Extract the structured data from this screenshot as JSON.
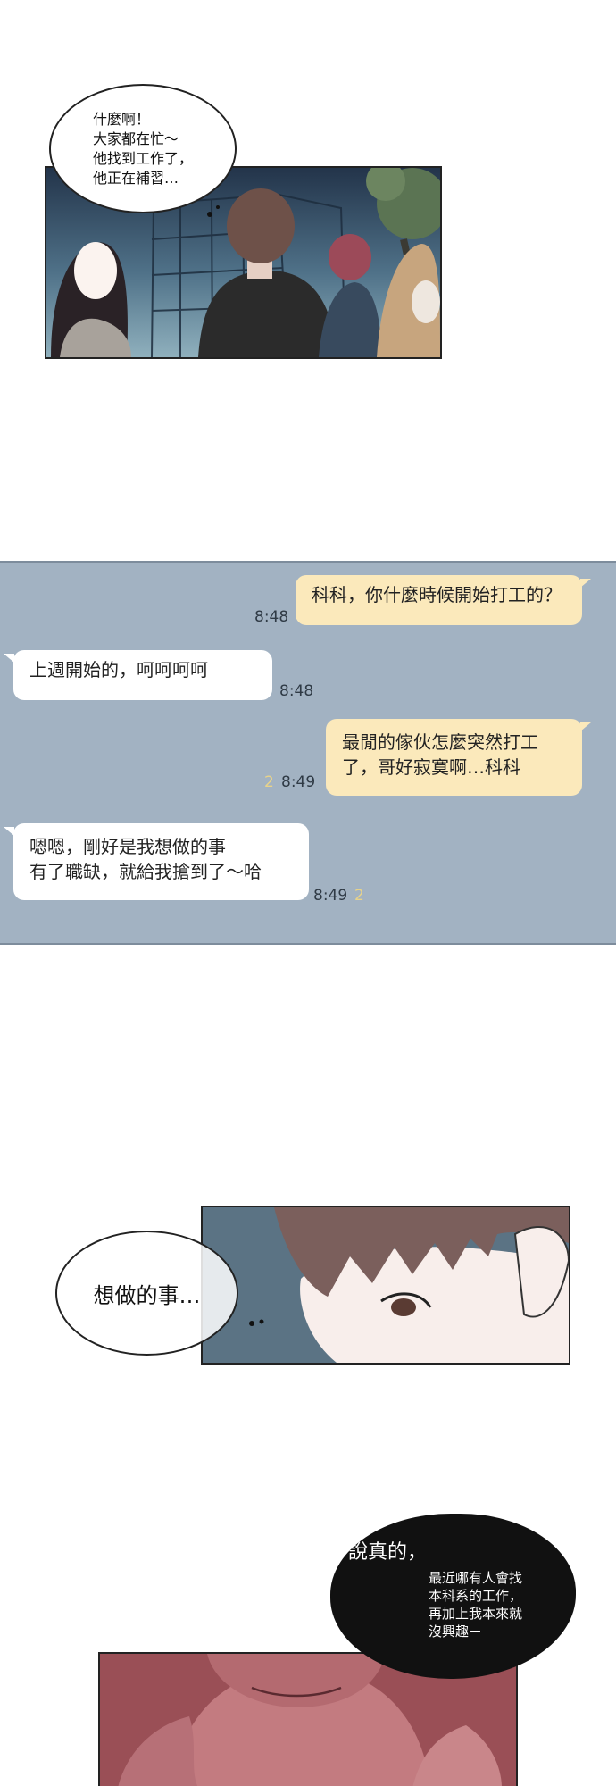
{
  "panel1": {
    "bubble_lines": [
      "什麼啊！",
      "大家都在忙～",
      "他找到工作了，",
      "他正在補習…"
    ]
  },
  "chat": {
    "messages": [
      {
        "side": "out",
        "lines": [
          "科科，你什麼時候開始打工的？"
        ],
        "time": "8:48",
        "unread": ""
      },
      {
        "side": "in",
        "lines": [
          "上週開始的，呵呵呵呵"
        ],
        "time": "8:48",
        "unread": ""
      },
      {
        "side": "out",
        "lines": [
          "最閒的傢伙怎麼突然打工",
          "了，哥好寂寞啊…科科"
        ],
        "time": "8:49",
        "unread": "2"
      },
      {
        "side": "in",
        "lines": [
          "嗯嗯，剛好是我想做的事",
          "有了職缺，就給我搶到了～哈"
        ],
        "time": "8:49",
        "unread": "2"
      }
    ]
  },
  "panel3": {
    "bubble_text": "想做的事…"
  },
  "panel4": {
    "bubble_title": "說真的，",
    "bubble_lines": [
      "最近哪有人會找",
      "本科系的工作，",
      "再加上我本來就",
      "沒興趣－"
    ]
  },
  "colors": {
    "chat_background": "#a2b2c2",
    "outgoing_bubble": "#fbe9bb",
    "incoming_bubble": "#ffffff",
    "unread_count": "#e8d38a"
  }
}
